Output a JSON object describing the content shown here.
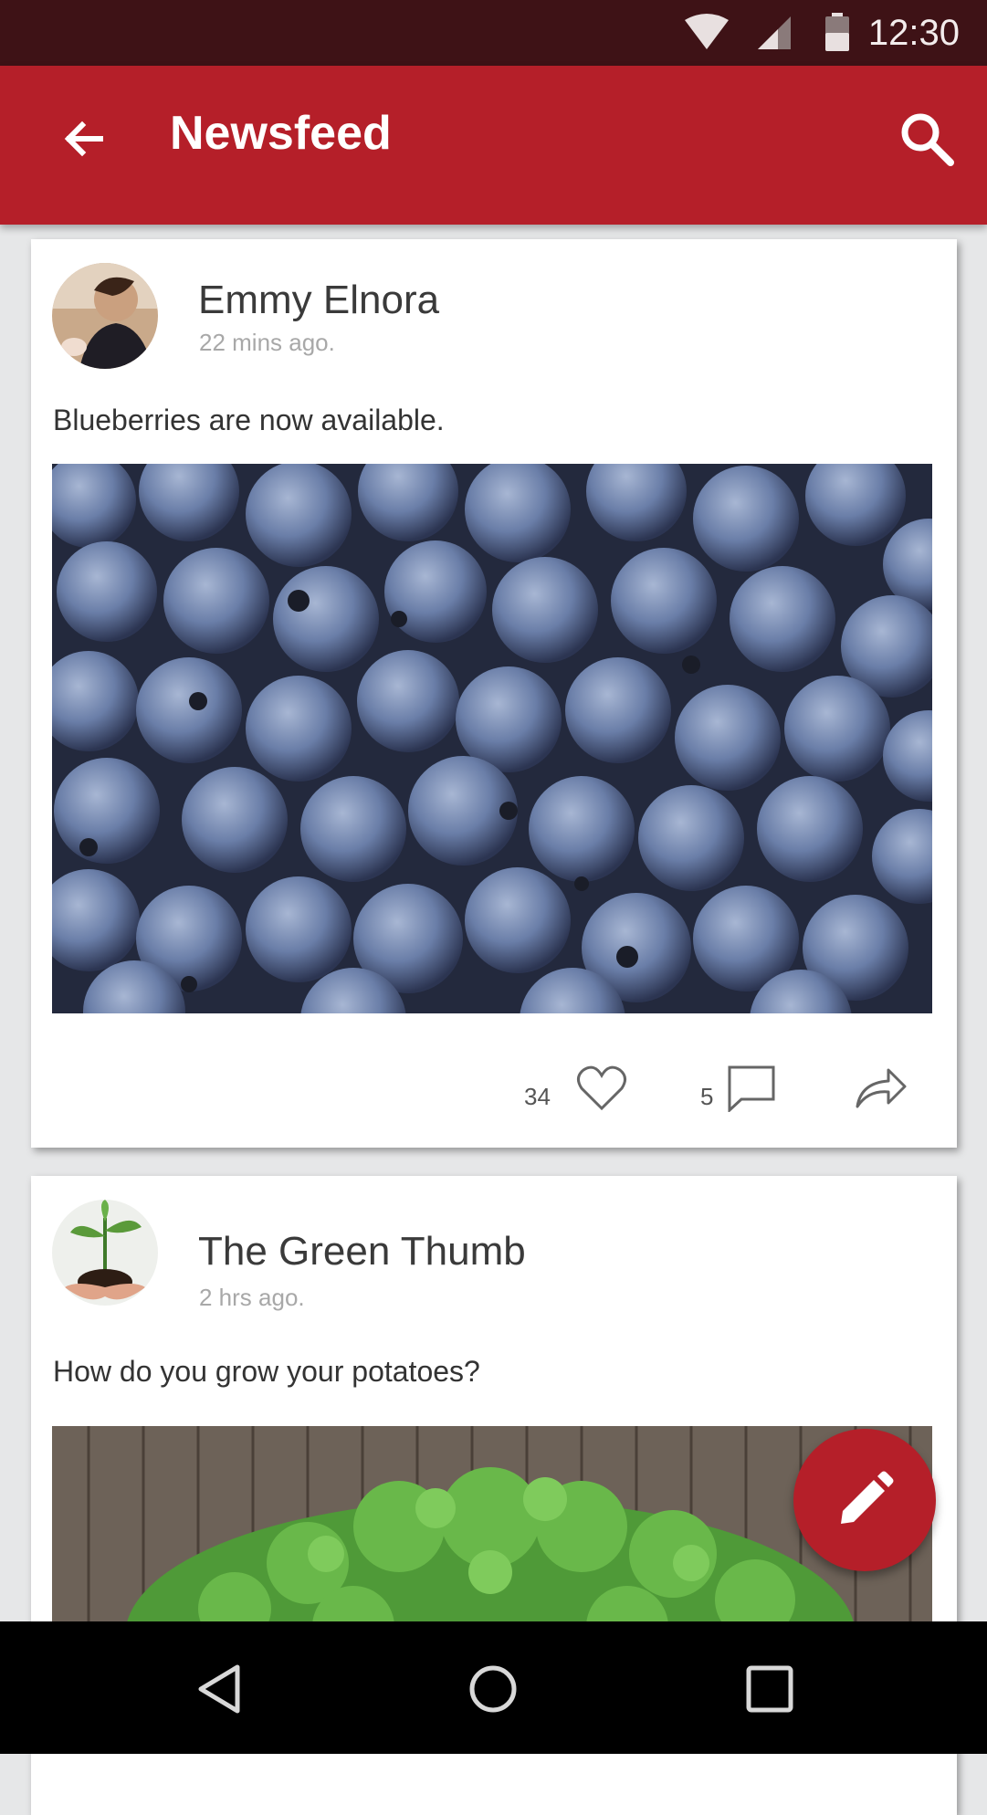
{
  "status_bar": {
    "time": "12:30"
  },
  "app_bar": {
    "title": "Newsfeed"
  },
  "posts": [
    {
      "author": "Emmy Elnora",
      "time_ago": "22 mins ago.",
      "text": "Blueberries are now available.",
      "likes": "34",
      "comments": "5"
    },
    {
      "author": "The Green Thumb",
      "time_ago": "2 hrs ago.",
      "text": "How do you grow your potatoes?"
    }
  ],
  "colors": {
    "primary": "#b51f29",
    "status_bar": "#3e1216",
    "background": "#e6e7e8"
  }
}
